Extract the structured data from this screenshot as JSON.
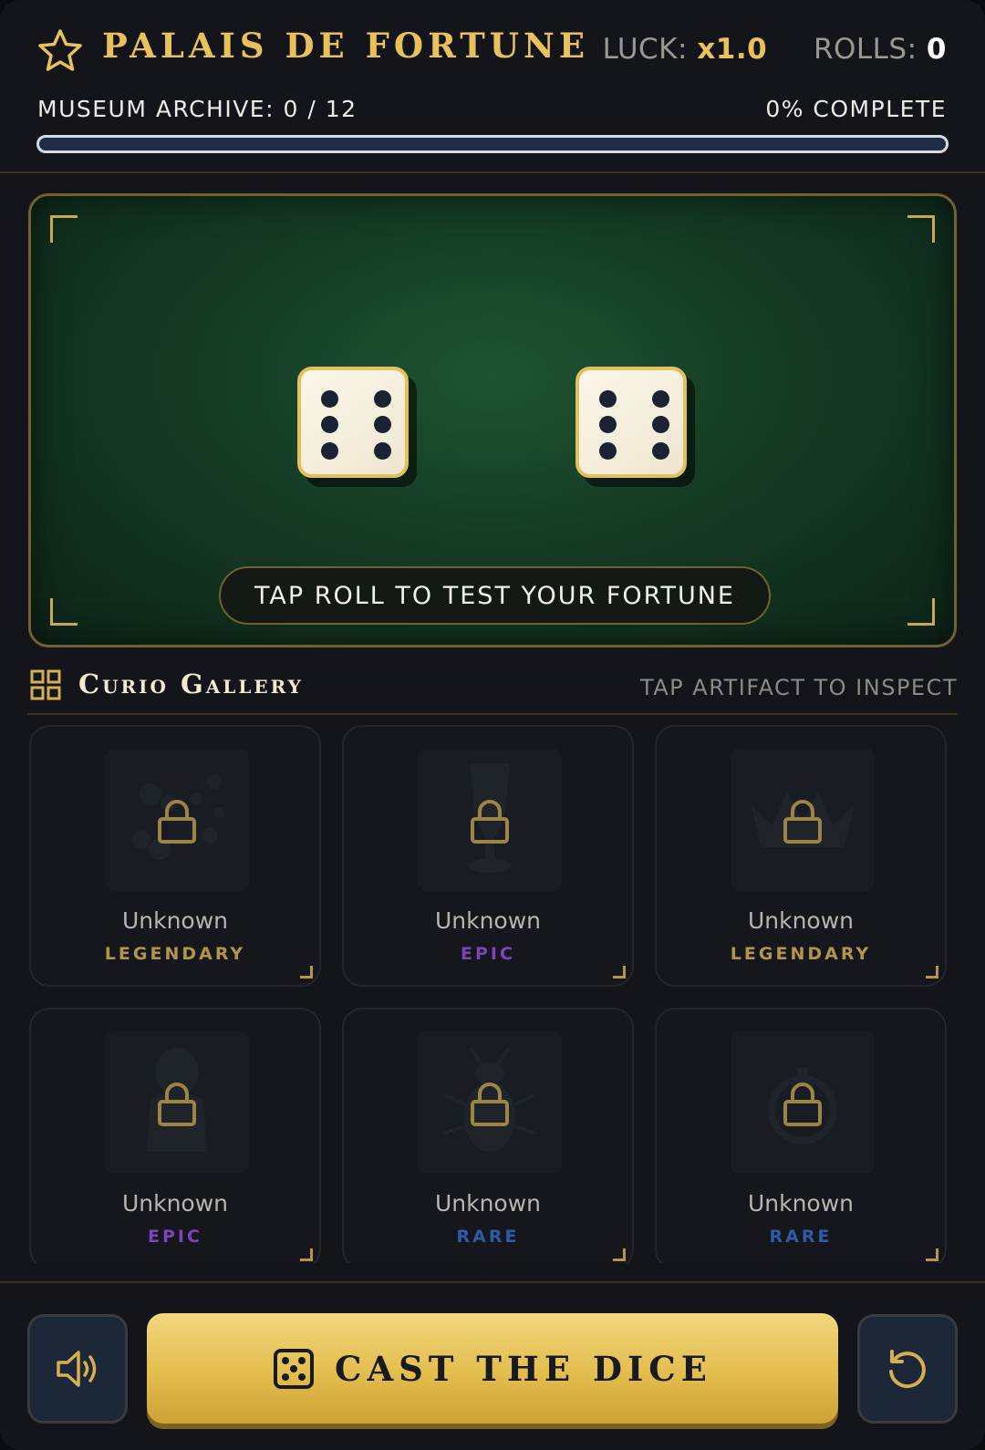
{
  "header": {
    "title": "PALAIS DE FORTUNE",
    "luck_label": "LUCK:",
    "luck_value": "x1.0",
    "rolls_label": "ROLLS:",
    "rolls_value": "0",
    "archive_label": "MUSEUM ARCHIVE: 0 / 12",
    "complete_label": "0% COMPLETE",
    "progress_fraction": 0
  },
  "table": {
    "dice": [
      6,
      6
    ],
    "prompt": "TAP ROLL TO TEST YOUR FORTUNE"
  },
  "gallery": {
    "title": "Curio Gallery",
    "hint": "TAP ARTIFACT TO INSPECT",
    "cards": [
      {
        "name": "Unknown",
        "rarity": "LEGENDARY",
        "silhouette": "flowers-icon"
      },
      {
        "name": "Unknown",
        "rarity": "EPIC",
        "silhouette": "chalice-icon"
      },
      {
        "name": "Unknown",
        "rarity": "LEGENDARY",
        "silhouette": "crown-icon"
      },
      {
        "name": "Unknown",
        "rarity": "EPIC",
        "silhouette": "bust-icon"
      },
      {
        "name": "Unknown",
        "rarity": "RARE",
        "silhouette": "beetle-icon"
      },
      {
        "name": "Unknown",
        "rarity": "RARE",
        "silhouette": "pocket-watch-icon"
      }
    ]
  },
  "footer": {
    "cast_label": "CAST THE DICE",
    "sound_icon": "speaker-icon",
    "reset_icon": "reset-icon"
  },
  "colors": {
    "gold": "#e8c15a",
    "legendary": "#b3954a",
    "epic": "#7a45b8",
    "rare": "#2f5ba6",
    "felt": "#1e5431",
    "background": "#13151b"
  }
}
